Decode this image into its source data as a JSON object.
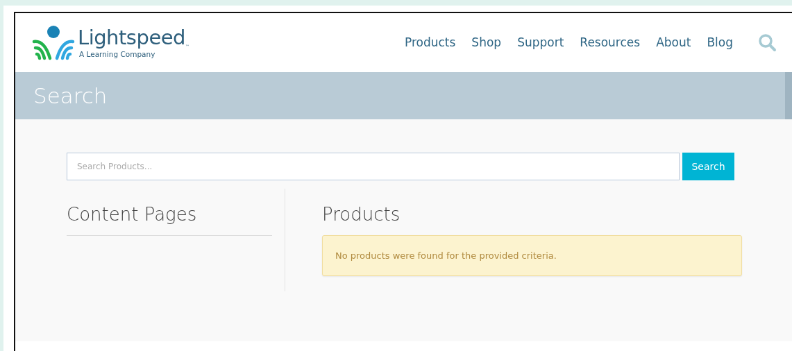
{
  "logo": {
    "name": "Lightspeed",
    "trademark": "™",
    "tagline": "A Learning Company"
  },
  "nav": [
    {
      "label": "Products"
    },
    {
      "label": "Shop"
    },
    {
      "label": "Support"
    },
    {
      "label": "Resources"
    },
    {
      "label": "About"
    },
    {
      "label": "Blog"
    }
  ],
  "page_title": "Search",
  "search": {
    "placeholder": "Search Products...",
    "button": "Search"
  },
  "content_pages": {
    "heading": "Content Pages"
  },
  "products": {
    "heading": "Products",
    "alert": "No products were found for the provided criteria."
  }
}
